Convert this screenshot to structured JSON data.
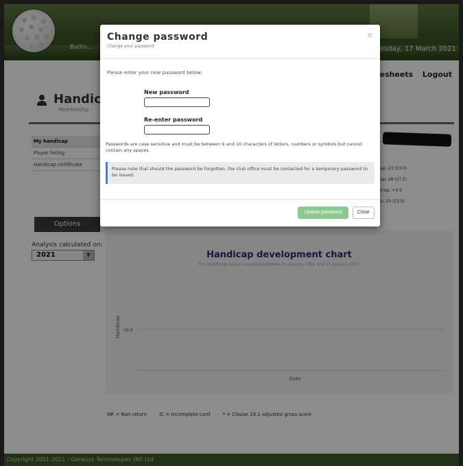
{
  "header": {
    "brand": "Ballin...",
    "date": "Wednesday, 17 March 2021"
  },
  "nav": {
    "timesheets": "Timesheets",
    "logout": "Logout"
  },
  "profile": {
    "title": "Handica",
    "subtitle": "Membership"
  },
  "sidebar": {
    "items": [
      {
        "label": "My handicap"
      },
      {
        "label": "Player listing"
      },
      {
        "label": "Handicap certificate"
      }
    ]
  },
  "options": {
    "button_label": "Options",
    "analysis_label": "Analysis calculated on:",
    "year_value": "2021"
  },
  "side_stats": [
    "cap: 23 (23.0)",
    "cap: 28 (27.5)",
    "dicap: +4.5",
    "ap: 23 (23.0)"
  ],
  "chart_data": {
    "type": "line",
    "title": "Handicap development chart",
    "subtitle": "For qualifying scores recorded between 01 January 2001 and 01 January 2001",
    "xlabel": "Date",
    "ylabel": "Handicap",
    "y_ticks": [
      "19.9"
    ],
    "series": []
  },
  "legend": {
    "nr": "NR = Non return",
    "ic": "IC = Incomplete card",
    "clause": "* = Clause 19.1 adjusted gross score"
  },
  "footer": {
    "copyright": "Copyright 2001-2021 - Genesys Technologies (NI) Ltd"
  },
  "modal": {
    "title": "Change password",
    "subtitle": "Change your password",
    "close_glyph": "×",
    "instruction": "Please enter your new password below:",
    "new_password_label": "New password",
    "reenter_label": "Re-enter password",
    "rules": "Passwords are case sensitive and must be between 6 and 10 characters of letters, numbers or symbols but cannot contain any spaces.",
    "alert": "Please note that should the password be forgotten, the club office must be contacted for a temporary password to be issued.",
    "update_button": "Update password",
    "close_button": "Close",
    "new_password_value": "",
    "reenter_value": ""
  }
}
